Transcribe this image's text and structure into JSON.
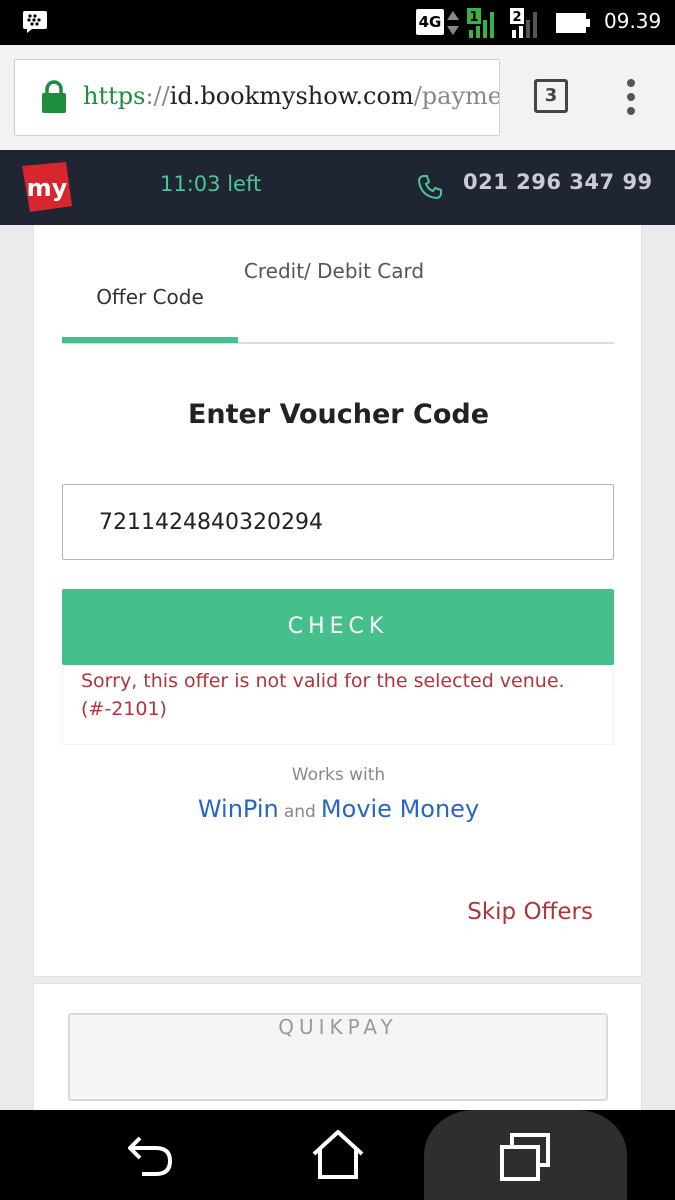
{
  "status_bar": {
    "network": "4G",
    "sim1": "1",
    "sim2": "2",
    "time": "09.39"
  },
  "browser": {
    "url_scheme": "https",
    "url_separator": "://",
    "url_host": "id.bookmyshow.com",
    "url_path": "/payme",
    "tab_count": "3"
  },
  "header": {
    "logo_text": "my",
    "timer": "11:03 left",
    "phone": "021 296 347 99"
  },
  "tabs": [
    {
      "label": "Offer Code"
    },
    {
      "label": "Credit/ Debit Card"
    }
  ],
  "voucher": {
    "heading": "Enter Voucher Code",
    "code_value": "7211424840320294",
    "check_label": "CHECK",
    "error": "Sorry, this offer is not valid for the selected venue. (#-2101)"
  },
  "works_with": {
    "label": "Works with",
    "brand1": "WinPin",
    "and": "and",
    "brand2": "Movie Money"
  },
  "skip_label": "Skip Offers",
  "quikpay_label": "QUIKPAY",
  "colors": {
    "accent": "#45bf8b",
    "error": "#b0353b",
    "link": "#2966c4",
    "header_bg": "#1f2533"
  }
}
